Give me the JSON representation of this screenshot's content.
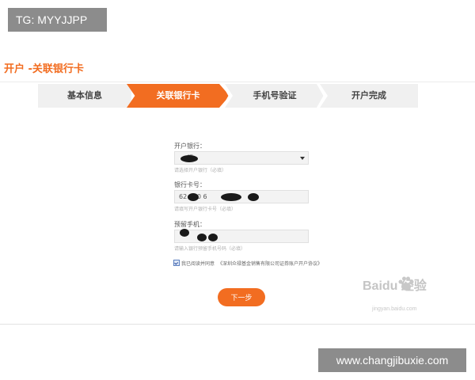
{
  "overlay": {
    "tg_label": "TG: MYYJJPP",
    "site_url": "www.changjibuxie.com"
  },
  "header": {
    "title": "开户 -关联银行卡"
  },
  "steps": [
    {
      "label": "基本信息",
      "active": false
    },
    {
      "label": "关联银行卡",
      "active": true
    },
    {
      "label": "手机号验证",
      "active": false
    },
    {
      "label": "开户完成",
      "active": false
    }
  ],
  "form": {
    "bank": {
      "label": "开户银行：",
      "value": "行",
      "hint": "请选择开户银行（必填）"
    },
    "card": {
      "label": "银行卡号：",
      "value": "62 100 6",
      "hint": "请填写开户银行卡号（必填）"
    },
    "phone": {
      "label": "预留手机：",
      "value": "",
      "hint": "请输入银行预留手机号码（必填）"
    },
    "agree": {
      "checked": true,
      "text": "我已阅读并同意",
      "link": "《深圳众禄基金销售有限公司证券账户开户协议》"
    },
    "next_label": "下一步"
  },
  "watermark": {
    "brand": "Baidu 经验",
    "sub": "jingyan.baidu.com"
  },
  "colors": {
    "accent": "#f26d21",
    "step_inactive": "#f0f0f0"
  }
}
